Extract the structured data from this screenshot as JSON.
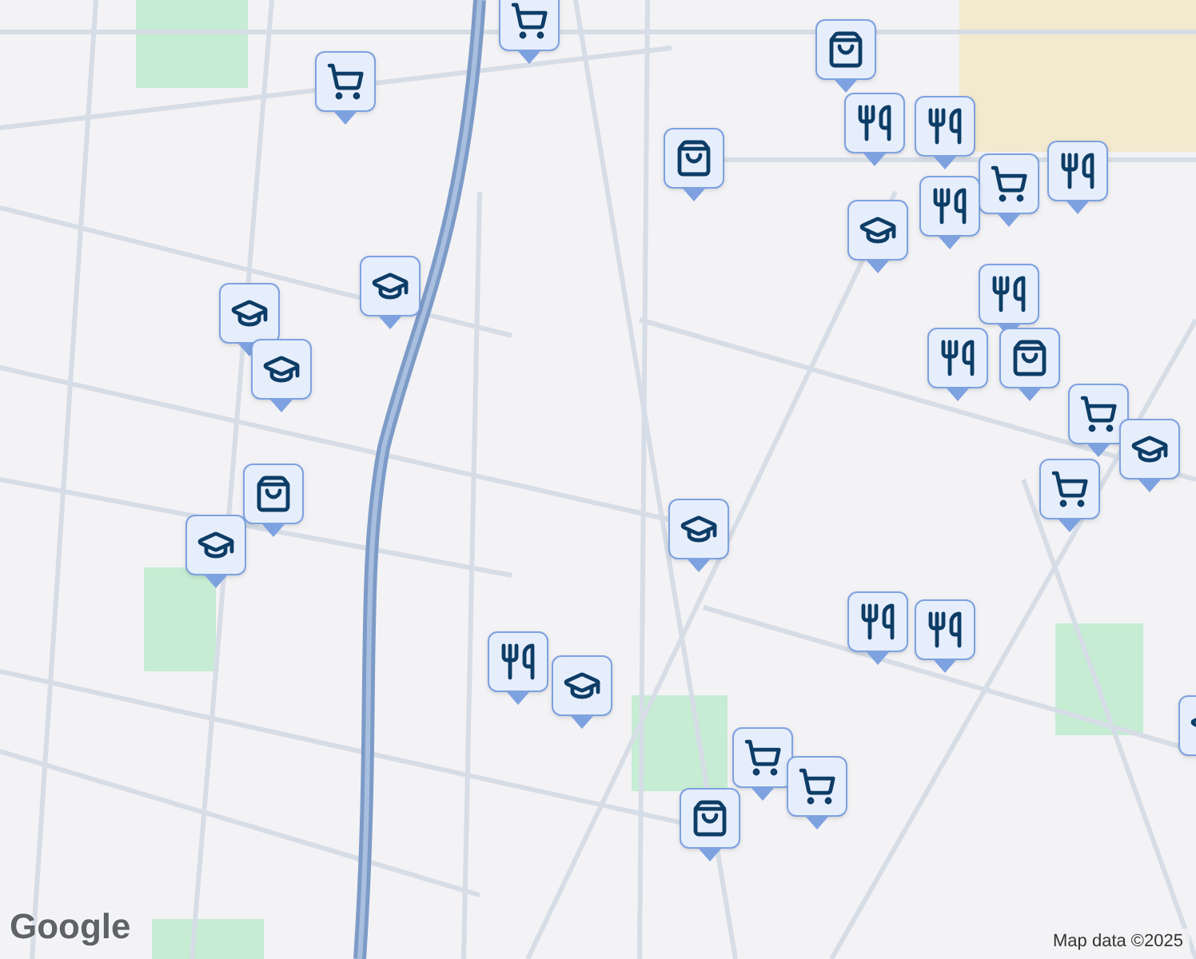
{
  "map": {
    "markers": [
      {
        "kind": "cart"
      },
      {
        "kind": "cart"
      },
      {
        "kind": "bag"
      },
      {
        "kind": "bag"
      },
      {
        "kind": "food"
      },
      {
        "kind": "food"
      },
      {
        "kind": "cart"
      },
      {
        "kind": "food"
      },
      {
        "kind": "food"
      },
      {
        "kind": "school"
      },
      {
        "kind": "food"
      },
      {
        "kind": "food"
      },
      {
        "kind": "bag"
      },
      {
        "kind": "cart"
      },
      {
        "kind": "school"
      },
      {
        "kind": "cart"
      },
      {
        "kind": "school"
      },
      {
        "kind": "school"
      },
      {
        "kind": "bag"
      },
      {
        "kind": "school"
      },
      {
        "kind": "school"
      },
      {
        "kind": "school"
      },
      {
        "kind": "food"
      },
      {
        "kind": "food"
      },
      {
        "kind": "food"
      },
      {
        "kind": "school"
      },
      {
        "kind": "cart"
      },
      {
        "kind": "cart"
      },
      {
        "kind": "bag"
      },
      {
        "kind": "school"
      }
    ]
  },
  "attribution": {
    "logo": "Google",
    "text": "Map data ©2025"
  }
}
